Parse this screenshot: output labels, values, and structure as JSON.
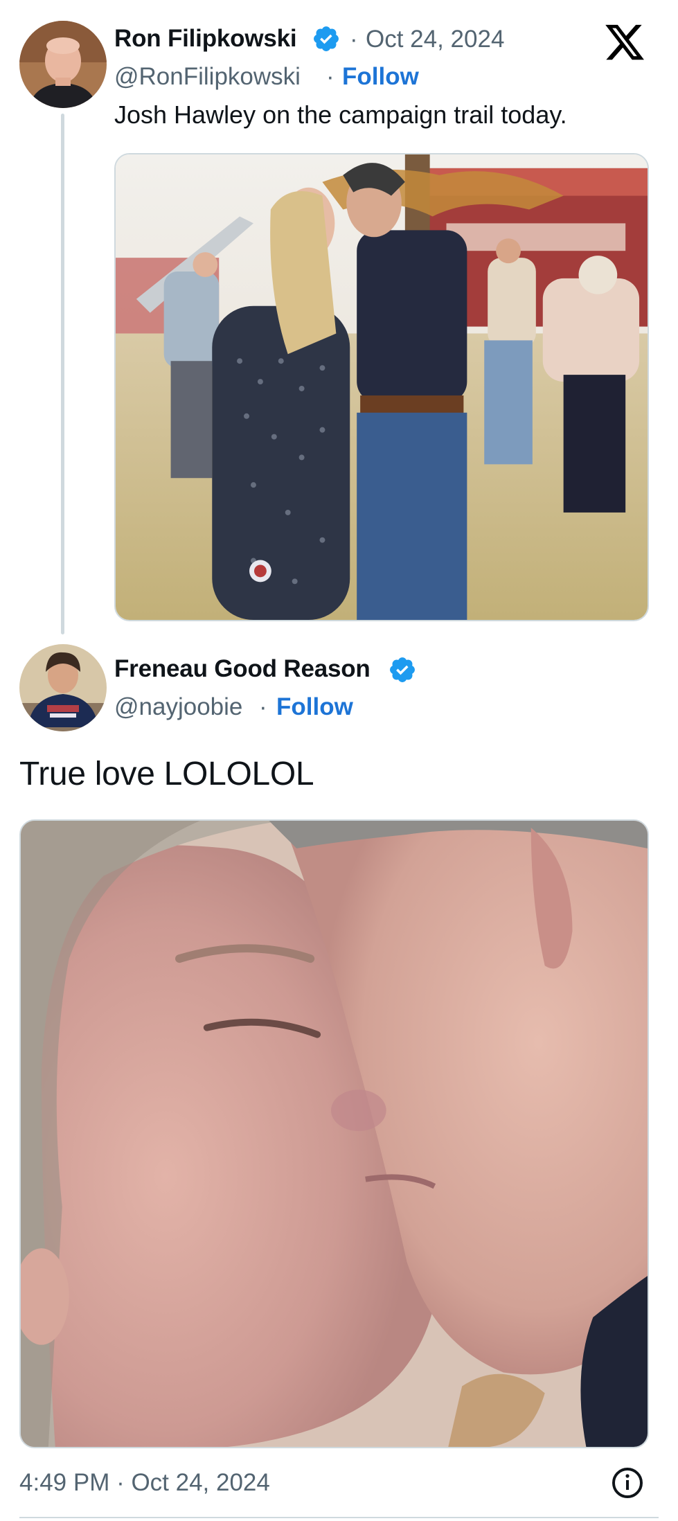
{
  "tweet": {
    "author_name": "Ron Filipkowski",
    "date": "Oct 24, 2024",
    "date_sep": "·",
    "handle": "@RonFilipkowski",
    "follow_sep": "·",
    "follow_label": "Follow",
    "text": "Josh Hawley on the campaign trail today."
  },
  "quote": {
    "author_name": "Freneau Good Reason",
    "handle": "@nayjoobie",
    "follow_sep": "·",
    "follow_label": "Follow",
    "text": "True love LOLOLOL"
  },
  "footer": {
    "timestamp": "4:49 PM · Oct 24, 2024"
  },
  "icons": {
    "verified": "verified-badge-icon",
    "brand": "x-logo-icon",
    "info": "info-icon"
  },
  "colors": {
    "follow": "#1d74d6",
    "verified": "#1d9bf0",
    "muted": "#536471",
    "divider": "#cfd9de"
  }
}
